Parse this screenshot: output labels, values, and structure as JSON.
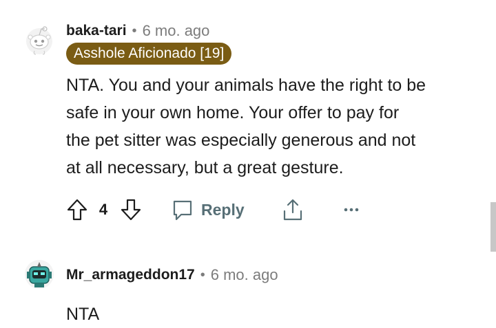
{
  "comments": [
    {
      "username": "baka-tari",
      "separator": "•",
      "time": "6 mo. ago",
      "flair": {
        "text": "Asshole Aficionado [19]",
        "bg": "#7a5c14",
        "color": "#ffffff"
      },
      "body_lines": [
        "NTA. You and your animals have the right to be",
        "safe in your own home. Your offer to pay for",
        "the pet sitter was especially generous and not",
        "at all necessary, but a great gesture."
      ],
      "vote_count": "4",
      "reply_label": "Reply",
      "avatar_icon": "snoo-avatar-icon"
    },
    {
      "username": "Mr_armageddon17",
      "separator": "•",
      "time": "6 mo. ago",
      "body_lines": [
        "NTA"
      ],
      "avatar_icon": "robot-avatar-icon"
    }
  ],
  "icons": {
    "upvote": "upvote-arrow-icon",
    "downvote": "downvote-arrow-icon",
    "reply": "speech-bubble-icon",
    "share": "share-icon",
    "more": "more-dots-icon"
  },
  "colors": {
    "meta_gray": "#7c7c7c",
    "action_gray": "#576f76"
  }
}
